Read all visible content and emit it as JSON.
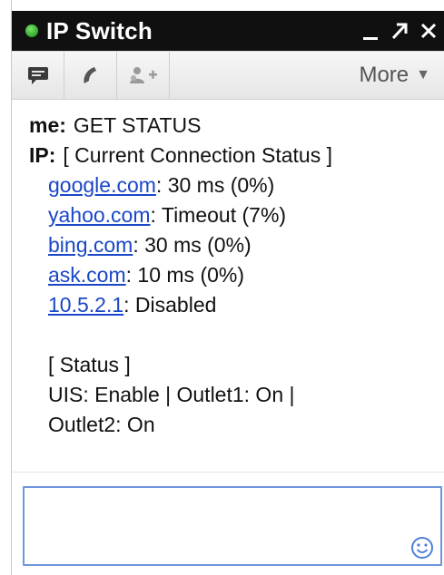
{
  "window": {
    "title": "IP Switch",
    "status_color": "#3cb034",
    "controls": [
      "minimize-icon",
      "popout-icon",
      "close-icon"
    ]
  },
  "toolbar": {
    "buttons": [
      "chat-bubble-icon",
      "phone-icon",
      "add-people-icon"
    ],
    "more_label": "More"
  },
  "conversation": {
    "me_label": "me:",
    "me_message": "GET STATUS",
    "ip_label": "IP:",
    "ip_header": "[ Current Connection Status ]",
    "hosts": [
      {
        "host": "google.com",
        "status": ": 30 ms (0%)"
      },
      {
        "host": "yahoo.com",
        "status": ": Timeout (7%)"
      },
      {
        "host": "bing.com",
        "status": ": 30 ms (0%)"
      },
      {
        "host": "ask.com",
        "status": ": 10 ms (0%)"
      },
      {
        "host": "10.5.2.1",
        "status": ": Disabled"
      }
    ],
    "status_header": "[ Status ]",
    "status_line1": "UIS: Enable | Outlet1: On |",
    "status_line2": "Outlet2: On"
  },
  "input": {
    "value": "",
    "emoji_icon": "smiley-icon"
  },
  "colors": {
    "titlebar": "#101010",
    "link": "#1a47c7",
    "input_border": "#6f95df"
  }
}
